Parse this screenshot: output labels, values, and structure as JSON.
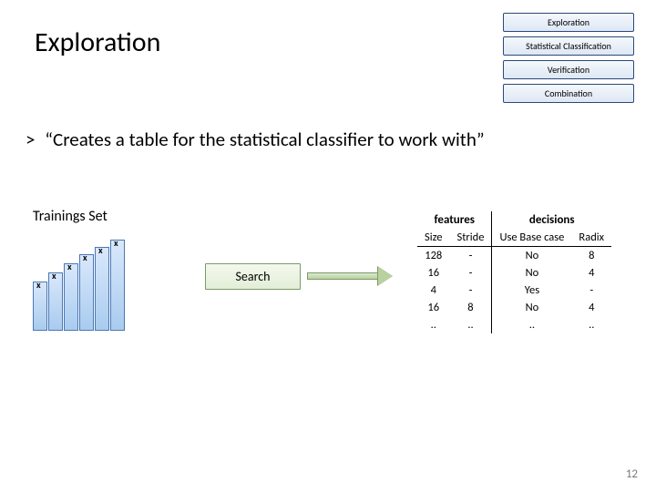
{
  "title": "Exploration",
  "nav": {
    "items": [
      "Exploration",
      "Statistical Classification",
      "Verification",
      "Combination"
    ]
  },
  "quote": "“Creates a table for the statistical classifier to work with”",
  "caret": ">",
  "trainings_label": "Trainings Set",
  "bar_mark": "x",
  "search_label": "Search",
  "table": {
    "group_features": "features",
    "group_decisions": "decisions",
    "cols": {
      "size": "Size",
      "stride": "Stride",
      "base": "Use Base case",
      "radix": "Radix"
    },
    "rows": [
      {
        "size": "128",
        "stride": "-",
        "base": "No",
        "radix": "8"
      },
      {
        "size": "16",
        "stride": "-",
        "base": "No",
        "radix": "4"
      },
      {
        "size": "4",
        "stride": "-",
        "base": "Yes",
        "radix": "-"
      },
      {
        "size": "16",
        "stride": "8",
        "base": "No",
        "radix": "4"
      },
      {
        "size": "..",
        "stride": "..",
        "base": "..",
        "radix": ".."
      }
    ]
  },
  "page_number": "12"
}
